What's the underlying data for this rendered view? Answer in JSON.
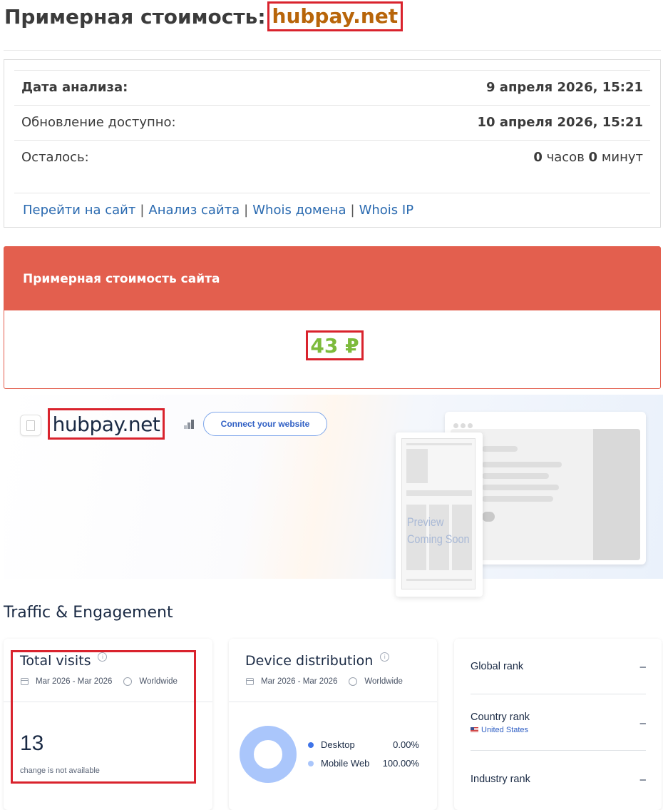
{
  "header": {
    "title_prefix": "Примерная стоимость:",
    "domain": "hubpay.net"
  },
  "info": {
    "rows": [
      {
        "label": "Дата анализа:",
        "value": "9 апреля 2026, 15:21"
      },
      {
        "label": "Обновление доступно:",
        "value": "10 апреля 2026, 15:21"
      },
      {
        "label": "Осталось:",
        "hours": "0",
        "hours_unit": "часов",
        "minutes": "0",
        "minutes_unit": "минут"
      }
    ],
    "links": [
      "Перейти на сайт",
      "Анализ сайта",
      "Whois домена",
      "Whois IP"
    ],
    "link_separator": "|"
  },
  "price": {
    "heading": "Примерная стоимость сайта",
    "value": "43 ₽"
  },
  "similarweb": {
    "domain": "hubpay.net",
    "connect_button": "Connect your website",
    "preview_line1": "Preview",
    "preview_line2": "Coming Soon"
  },
  "traffic": {
    "section_title": "Traffic & Engagement",
    "total_visits": {
      "title": "Total visits",
      "info_icon": "i",
      "period": "Mar 2026 - Mar 2026",
      "region": "Worldwide",
      "value": "13",
      "note": "change is not available"
    },
    "device_distribution": {
      "title": "Device distribution",
      "info_icon": "i",
      "period": "Mar 2026 - Mar 2026",
      "region": "Worldwide",
      "items": [
        {
          "label": "Desktop",
          "value": "0.00%",
          "color": "#3f74e8"
        },
        {
          "label": "Mobile Web",
          "value": "100.00%",
          "color": "#aac6fb"
        }
      ]
    },
    "ranks": {
      "global_label": "Global rank",
      "global_value": "–",
      "country_label": "Country rank",
      "country_sub": "United States",
      "country_value": "–",
      "industry_label": "Industry rank",
      "industry_value": "–"
    }
  },
  "colors": {
    "domain_text": "#b8650a",
    "price_header": "#e35f4e",
    "price_value": "#7dbb3c",
    "highlight_box": "#d9232d",
    "link": "#2a6ab0"
  }
}
